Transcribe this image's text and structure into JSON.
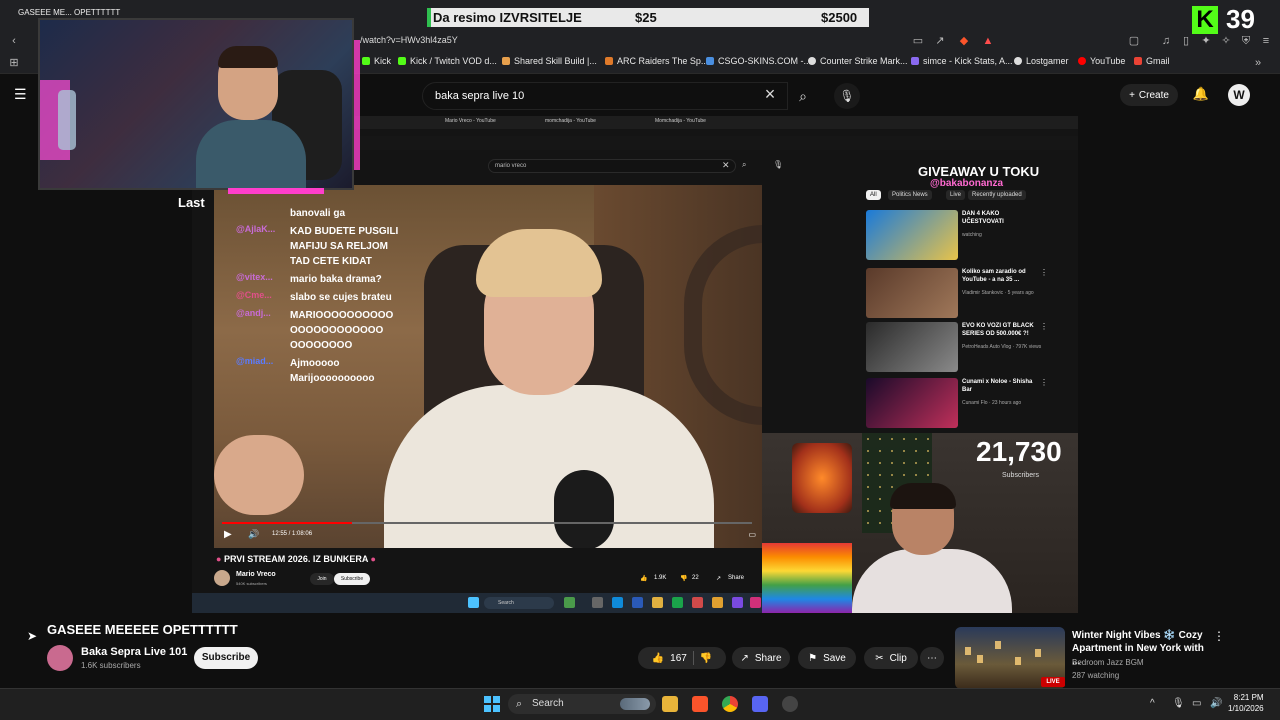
{
  "browser": {
    "tab_title": "GASEEE ME... OPETTTTTT",
    "url": "/watch?v=HWv3hl4za5Y",
    "bookmarks": [
      "Kick",
      "Kick / Twitch VOD d...",
      "Shared Skill Build |...",
      "ARC Raiders The Sp...",
      "CSGO-SKINS.COM -...",
      "Counter Strike Mark...",
      "simce - Kick Stats, A...",
      "Lostgamer",
      "YouTube",
      "Gmail"
    ]
  },
  "overlay": {
    "donation_text": "Da resimo IZVRSITELJE",
    "donation_current": "$25",
    "donation_goal": "$2500",
    "kick_logo": "K",
    "kick_count": "39",
    "last_label": "Last",
    "subscriber_count": "21,730",
    "subscriber_label": "Subscribers"
  },
  "youtube_header": {
    "search_query": "baka sepra live 10",
    "create_label": "Create"
  },
  "inner_page": {
    "tabs": [
      "Mario Vreco - YouTube",
      "momchadija - YouTube",
      "Momchadija - YouTube"
    ],
    "search_query": "mario vreco",
    "chat": [
      {
        "user": "",
        "text": "banovali ga",
        "color": "purple"
      },
      {
        "user": "@AjlaK...",
        "text": "KAD BUDETE PUSGILI MAFIJU SA RELJOM TAD CETE KIDAT",
        "color": "purple"
      },
      {
        "user": "@vitex...",
        "text": "mario baka drama?",
        "color": "purple"
      },
      {
        "user": "@Cme...",
        "text": "slabo se cujes brateu",
        "color": "pink"
      },
      {
        "user": "@andj...",
        "text": "MARIOOOOOOOOOO OOOOOOOOOOOO OOOOOOOO",
        "color": "purple"
      },
      {
        "user": "@miad...",
        "text": "Ajmooooo Marijoooooooooo",
        "color": "blue"
      }
    ],
    "video_time": "12:55 / 1:08:06",
    "video_title": "PRVI STREAM 2026. IZ BUNKERA",
    "channel_name": "Mario Vreco",
    "channel_subs": "540K subscribers",
    "join_label": "Join",
    "subscribe_label": "Subscribe",
    "likes": "1.9K",
    "dislikes": "22",
    "share_label": "Share",
    "taskbar_search": "Search",
    "giveaway_title": "GIVEAWAY U TOKU",
    "giveaway_handle": "@bakabonanza",
    "chips": [
      "All",
      "Politics News",
      "Live",
      "Recently uploaded"
    ],
    "related": [
      {
        "title": "DAN 4 KAKO UČESTVOVATI",
        "meta": "watching"
      },
      {
        "title": "Koliko sam zaradio od YouTube - a na 35 ...",
        "meta": "Vladimir Stankovic · 5 years ago"
      },
      {
        "title": "EVO KO VOZI GT BLACK SERIES OD 500.000€ ?!",
        "meta": "PetroHeads Auto Vlog · 797K views"
      },
      {
        "title": "Cunami x Noloe - Shisha Bar",
        "meta": "Cunami Flo · 23 hours ago"
      }
    ]
  },
  "video": {
    "title": "GASEEE MEEEEE OPETTTTTT",
    "channel": "Baka Sepra Live 101",
    "subscribers": "1.6K subscribers",
    "subscribe_label": "Subscribe",
    "likes": "167",
    "share_label": "Share",
    "save_label": "Save",
    "clip_label": "Clip"
  },
  "recommended": {
    "title": "Winter Night Vibes ❄️ Cozy Apartment in New York with ...",
    "channel": "Bedroom Jazz BGM",
    "watching": "287 watching",
    "live_badge": "LIVE"
  },
  "taskbar": {
    "search_label": "Search",
    "time": "8:21 PM",
    "date": "1/10/2026"
  }
}
